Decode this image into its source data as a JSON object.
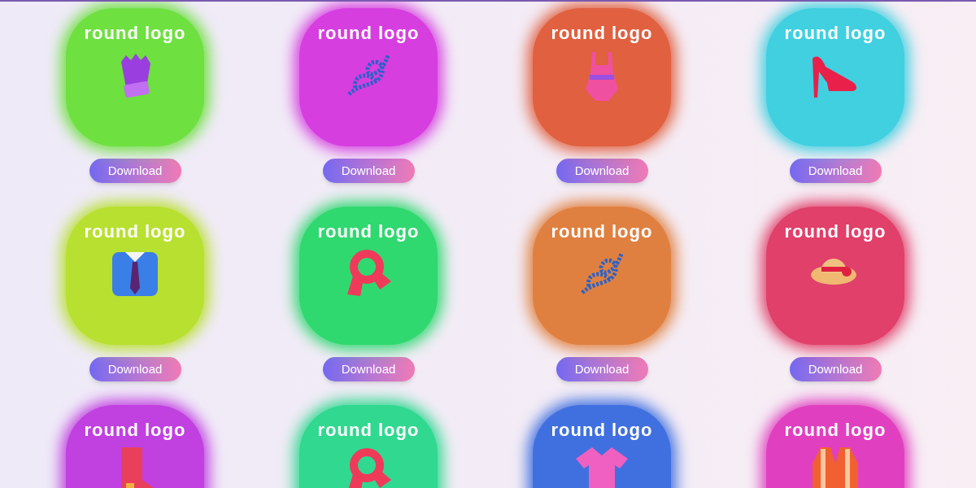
{
  "tiles": [
    {
      "title": "round logo",
      "color": "#6ee040",
      "kind": "glove",
      "button": "Download"
    },
    {
      "title": "round logo",
      "color": "#d63ee0",
      "kind": "knot",
      "button": "Download"
    },
    {
      "title": "round logo",
      "color": "#e06040",
      "kind": "swimsuit",
      "button": "Download"
    },
    {
      "title": "round logo",
      "color": "#40d0e0",
      "kind": "heel",
      "button": "Download"
    },
    {
      "title": "round logo",
      "color": "#b8e030",
      "kind": "shirt",
      "button": "Download"
    },
    {
      "title": "round logo",
      "color": "#30d870",
      "kind": "scarf",
      "button": "Download"
    },
    {
      "title": "round logo",
      "color": "#e08040",
      "kind": "knot",
      "button": "Download"
    },
    {
      "title": "round logo",
      "color": "#e0406a",
      "kind": "hat",
      "button": "Download"
    },
    {
      "title": "round logo",
      "color": "#c040e0",
      "kind": "boot"
    },
    {
      "title": "round logo",
      "color": "#30d890",
      "kind": "scarf"
    },
    {
      "title": "round logo",
      "color": "#4070e0",
      "kind": "tshirt"
    },
    {
      "title": "round logo",
      "color": "#e040c0",
      "kind": "vest"
    }
  ]
}
